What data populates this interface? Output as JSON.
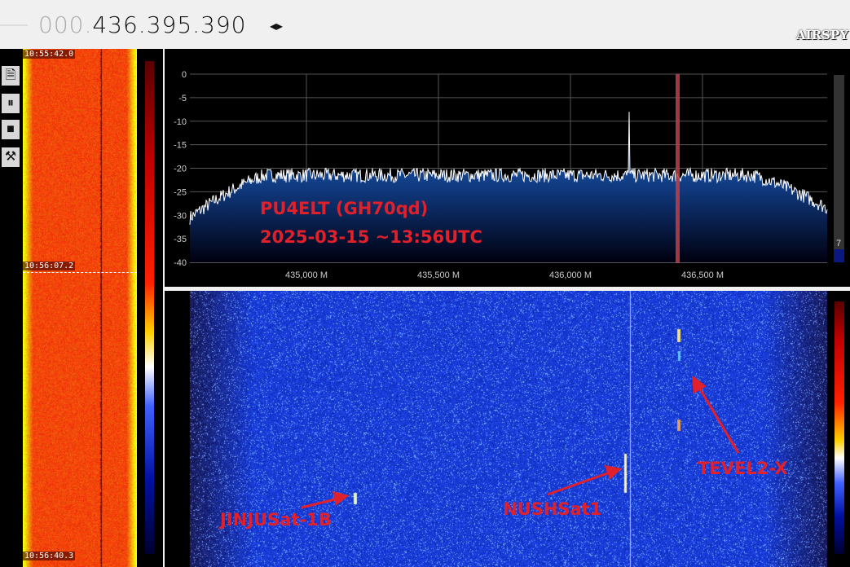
{
  "header": {
    "freq_dim": "000.",
    "freq_main": "436.395.390",
    "tune_arrows": "◂▸",
    "logo": "AIRSPY"
  },
  "toolbar": {
    "items": [
      {
        "name": "document-icon",
        "glyph": "🗎"
      },
      {
        "name": "pause-icon",
        "glyph": "⏸"
      },
      {
        "name": "stop-icon",
        "glyph": "■"
      },
      {
        "name": "tools-icon",
        "glyph": "⚒"
      }
    ]
  },
  "left_waterfall": {
    "timestamps": [
      "10:55:42.0",
      "10:56:07.2",
      "10:56:40.3"
    ]
  },
  "spectrum": {
    "y_ticks": [
      "0",
      "-5",
      "-10",
      "-15",
      "-20",
      "-25",
      "-30",
      "-35",
      "-40"
    ],
    "x_ticks": [
      "435,000 M",
      "435,500 M",
      "436,000 M",
      "436,500 M"
    ],
    "level_value": "7",
    "annotation_line1": "PU4ELT (GH70qd)",
    "annotation_line2": "2025-03-15 ~13:56UTC",
    "colors": {
      "fill": "#1a5fb0",
      "trace": "#ffffff",
      "marker": "#c0404a"
    }
  },
  "waterfall": {
    "labels": {
      "jinju": "JINJUSat-1B",
      "nush": "NUSHSat1",
      "tevel": "TEVEL2-X"
    },
    "label_color": "#e0202a"
  }
}
